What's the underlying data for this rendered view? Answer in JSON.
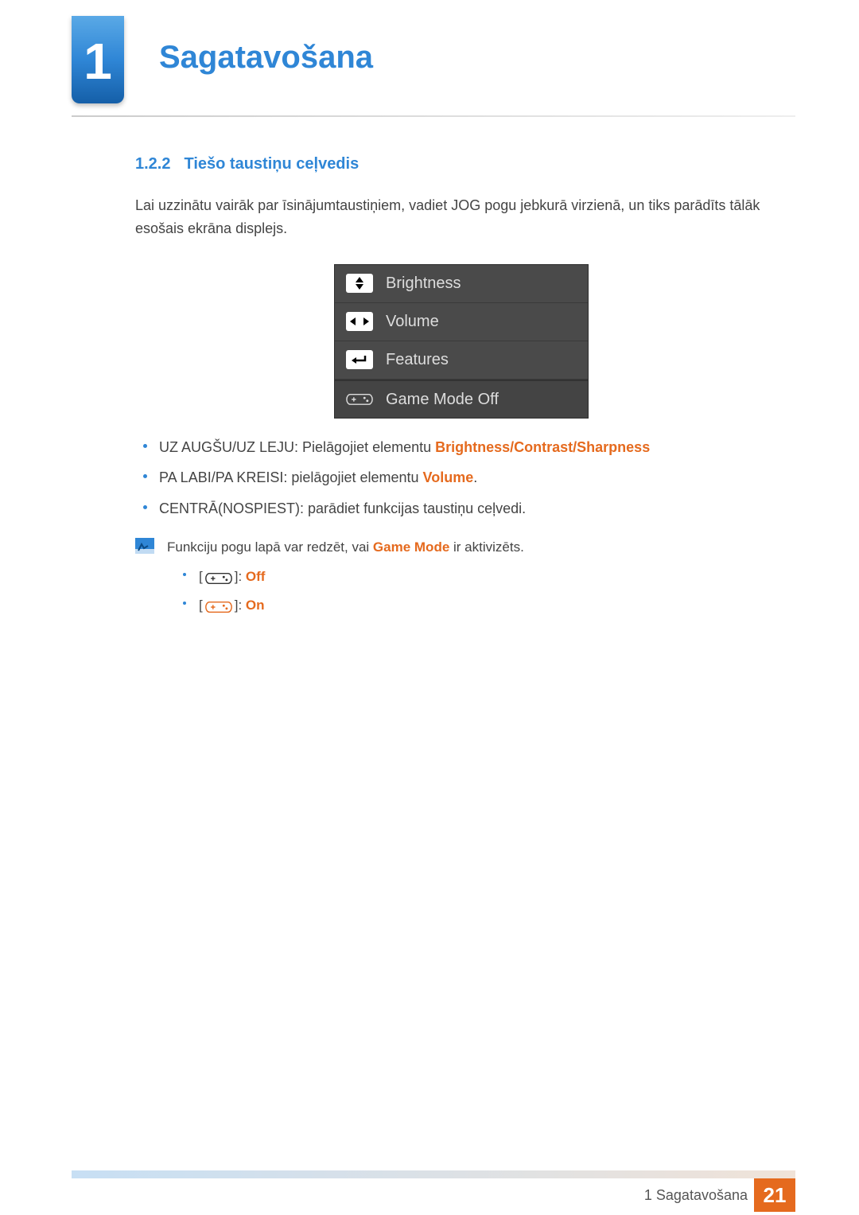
{
  "chapter": {
    "number": "1",
    "title": "Sagatavošana"
  },
  "section": {
    "number": "1.2.2",
    "title": "Tiešo taustiņu ceļvedis"
  },
  "intro": "Lai uzzinātu vairāk par īsinājumtaustiņiem, vadiet JOG pogu jebkurā virzienā, un tiks parādīts tālāk esošais ekrāna displejs.",
  "osd": {
    "rows": [
      {
        "icon": "up-down-icon",
        "label": "Brightness"
      },
      {
        "icon": "left-right-icon",
        "label": "Volume"
      },
      {
        "icon": "enter-icon",
        "label": "Features"
      },
      {
        "icon": "gamepad-icon",
        "label": "Game Mode Off"
      }
    ]
  },
  "bullets": [
    {
      "prefix": "UZ AUGŠU/UZ LEJU: Pielāgojiet elementu ",
      "hl": "Brightness/Contrast/Sharpness",
      "suffix": ""
    },
    {
      "prefix": "PA LABI/PA KREISI: pielāgojiet elementu ",
      "hl": "Volume",
      "suffix": "."
    },
    {
      "prefix": "CENTRĀ(NOSPIEST): parādiet funkcijas taustiņu ceļvedi.",
      "hl": "",
      "suffix": ""
    }
  ],
  "note": {
    "text_pre": "Funkciju pogu lapā var redzēt, vai ",
    "text_hl": "Game Mode",
    "text_post": " ir aktivizēts.",
    "sub": [
      {
        "bracket_open": "[",
        "bracket_close": "]: ",
        "state": "Off",
        "color": "#333"
      },
      {
        "bracket_open": "[",
        "bracket_close": "]: ",
        "state": "On",
        "color": "#e56a1e"
      }
    ]
  },
  "footer": {
    "label": "1 Sagatavošana",
    "page": "21"
  }
}
